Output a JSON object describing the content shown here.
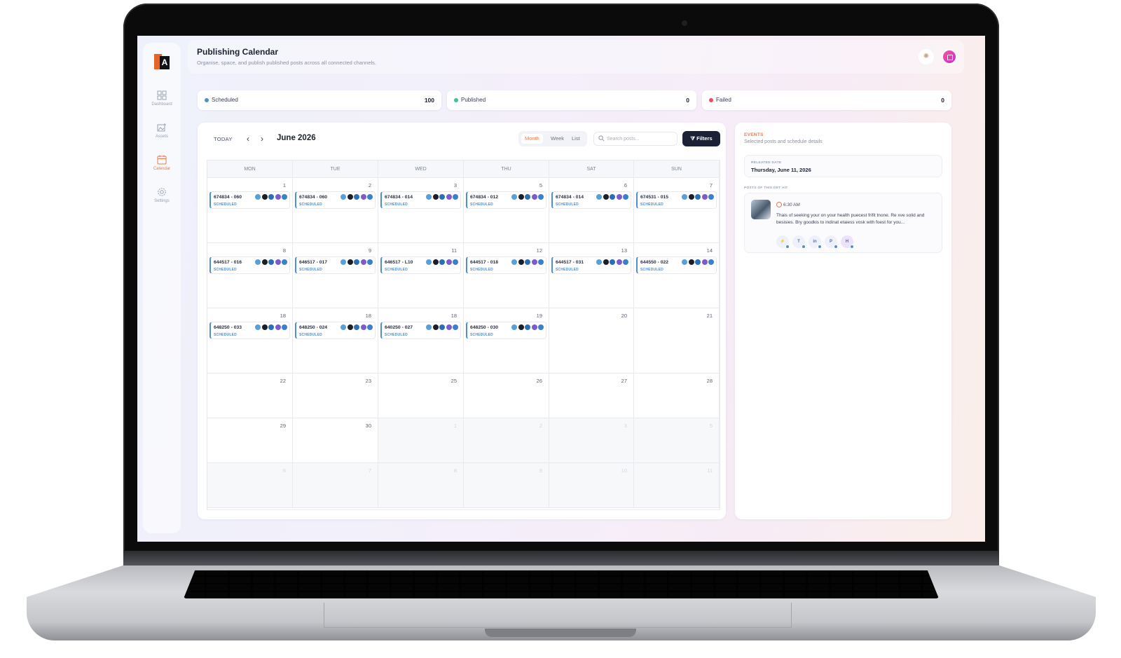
{
  "app": {
    "title": "Publishing Calendar",
    "subtitle": "Organise, space, and publish published posts across all connected channels."
  },
  "sidebar": {
    "items": [
      {
        "label": "Dashboard",
        "icon": "grid-icon"
      },
      {
        "label": "Assets",
        "icon": "image-icon"
      },
      {
        "label": "Calendar",
        "icon": "calendar-icon",
        "active": true
      },
      {
        "label": "Settings",
        "icon": "gear-icon"
      }
    ]
  },
  "stats": [
    {
      "label": "Scheduled",
      "value": "100",
      "color": "#4f8fd0"
    },
    {
      "label": "Published",
      "value": "0",
      "color": "#3cc48a"
    },
    {
      "label": "Failed",
      "value": "0",
      "color": "#ee4d5f"
    }
  ],
  "toolbar": {
    "today": "TODAY",
    "month": "June 2026",
    "views": [
      "Month",
      "Week",
      "List"
    ],
    "active_view": "Month",
    "search_placeholder": "Search posts...",
    "filters": "Filters"
  },
  "weekdays": [
    "MON",
    "TUE",
    "WED",
    "THU",
    "SAT",
    "SUN"
  ],
  "weeks": [
    [
      {
        "day": "1",
        "code": "674834 - 060",
        "status": "SCHEDULED"
      },
      {
        "day": "2",
        "code": "674834 - 060",
        "status": "SCHEDULED"
      },
      {
        "day": "3",
        "code": "674834 - 014",
        "status": "SCHEDULED"
      },
      {
        "day": "5",
        "code": "674834 - 012",
        "status": "SCHEDULED"
      },
      {
        "day": "6",
        "code": "674834 - 014",
        "status": "SCHEDULED"
      },
      {
        "day": "7",
        "code": "674531 - 015",
        "status": "SCHEDULED"
      }
    ],
    [
      {
        "day": "8",
        "code": "644517 - 016",
        "status": "SCHEDULED"
      },
      {
        "day": "9",
        "code": "646517 - 017",
        "status": "SCHEDULED"
      },
      {
        "day": "11",
        "code": "646517 - L10",
        "status": "SCHEDULED"
      },
      {
        "day": "12",
        "code": "644517 - 018",
        "status": "SCHEDULED"
      },
      {
        "day": "13",
        "code": "644517 - 031",
        "status": "SCHEDULED"
      },
      {
        "day": "14",
        "code": "644550 - 022",
        "status": "SCHEDULED"
      }
    ],
    [
      {
        "day": "18",
        "code": "648250 - 033",
        "status": "SCHEDULED"
      },
      {
        "day": "18",
        "code": "648250 - 024",
        "status": "SCHEDULED"
      },
      {
        "day": "18",
        "code": "640250 - 027",
        "status": "SCHEDULED"
      },
      {
        "day": "19",
        "code": "648250 - 030",
        "status": "SCHEDULED"
      },
      {
        "day": "20"
      },
      {
        "day": "21"
      }
    ],
    [
      {
        "day": "22"
      },
      {
        "day": "23"
      },
      {
        "day": "25"
      },
      {
        "day": "26"
      },
      {
        "day": "27"
      },
      {
        "day": "28"
      }
    ],
    [
      {
        "day": "29"
      },
      {
        "day": "30"
      },
      {
        "day": "1",
        "muted": true
      },
      {
        "day": "2",
        "muted": true
      },
      {
        "day": "3",
        "muted": true
      },
      {
        "day": "5",
        "muted": true
      }
    ],
    [
      {
        "day": "6",
        "muted": true
      },
      {
        "day": "7",
        "muted": true
      },
      {
        "day": "8",
        "muted": true
      },
      {
        "day": "9",
        "muted": true
      },
      {
        "day": "10",
        "muted": true
      },
      {
        "day": "11",
        "muted": true
      }
    ]
  ],
  "channel_icon_colors": [
    "#5aa0d8",
    "#1b1f2a",
    "#2a6fb5",
    "#7a5cd0",
    "#3a7fd0"
  ],
  "events_panel": {
    "heading": "EVENTS",
    "subheading": "Selected posts and schedule details",
    "date_label": "RELEATED DATE",
    "date_value": "Thursday, June 11, 2026",
    "posts_heading": "POSTS OF THIS DET AIT",
    "post": {
      "time": "6:30 AM",
      "text": "Thais of seeking your on your health puecest frifit tnone. Re xve solid and besisies. Bry goodkis to indinat etaiess vosk with foest for you...",
      "channels": [
        "⚡",
        "T",
        "in",
        "P",
        "H"
      ]
    }
  }
}
